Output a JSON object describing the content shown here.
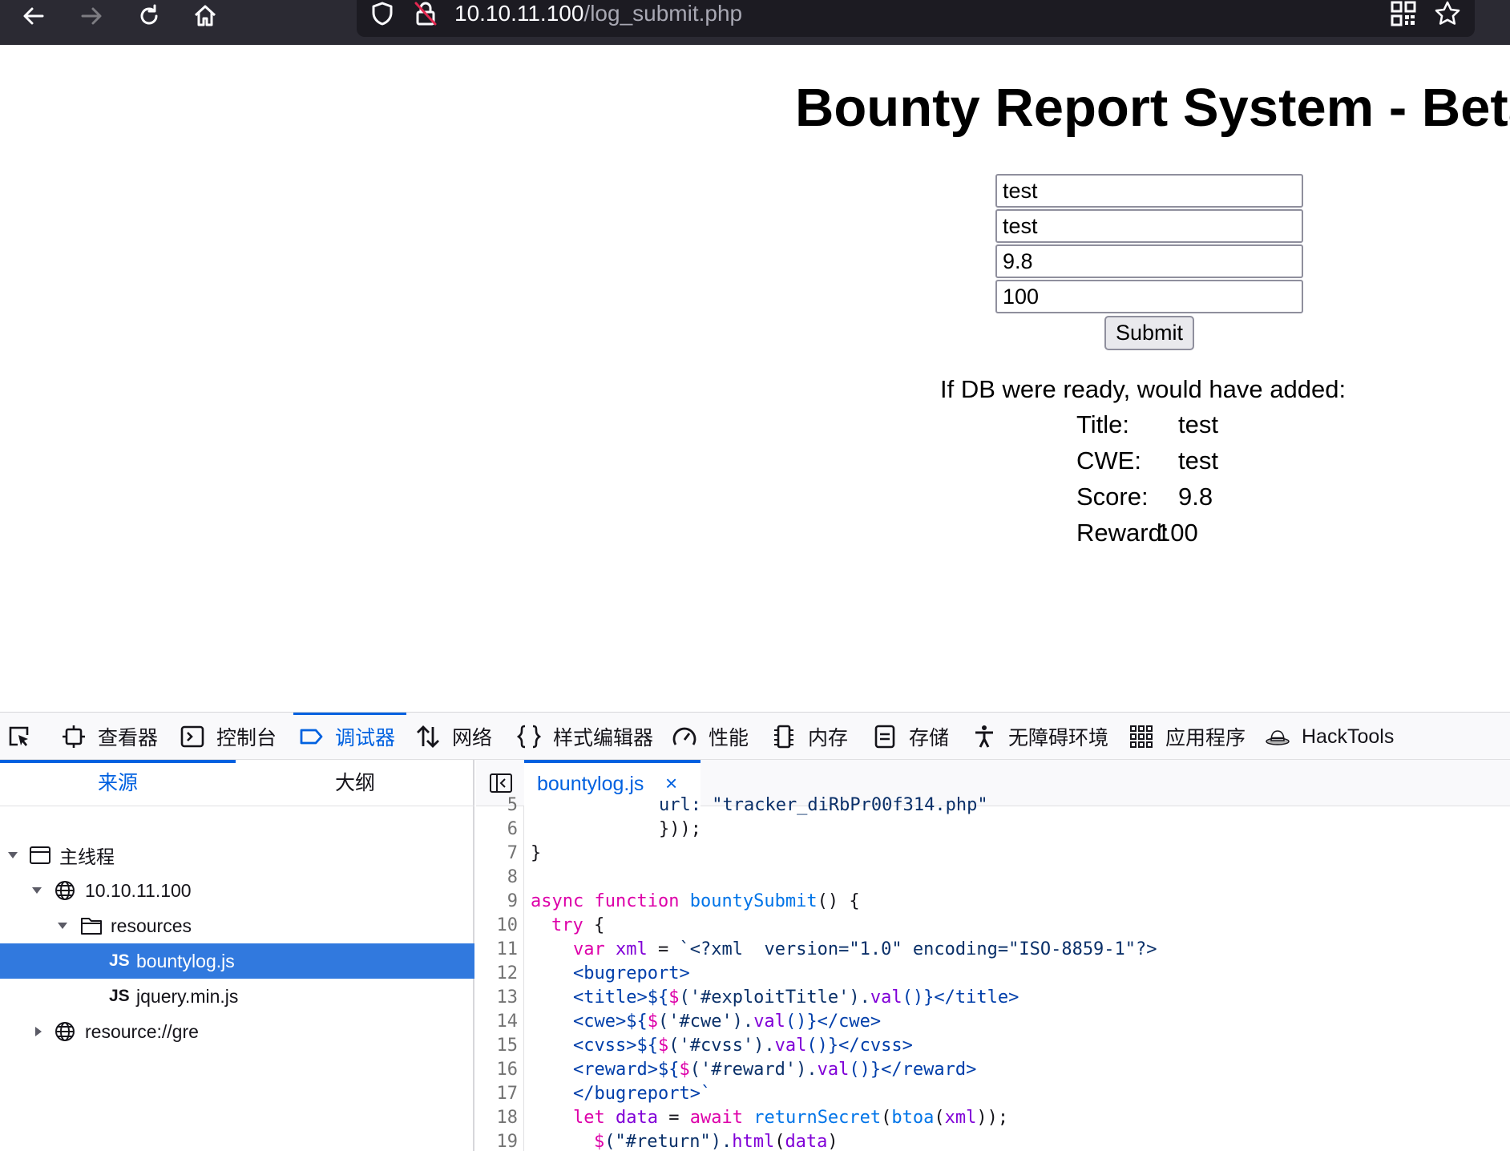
{
  "browser": {
    "url_host": "10.10.11.100",
    "url_path": "/log_submit.php"
  },
  "page": {
    "title": "Bounty Report System - Beta",
    "fields": {
      "title_value": "test",
      "cwe_value": "test",
      "score_value": "9.8",
      "reward_value": "100"
    },
    "submit_label": "Submit",
    "result_message": "If DB were ready, would have added:",
    "results": [
      {
        "label": "Title:",
        "value": "test"
      },
      {
        "label": "CWE:",
        "value": "test"
      },
      {
        "label": "Score:",
        "value": "9.8"
      },
      {
        "label": "Reward:",
        "value": "100"
      }
    ]
  },
  "devtools": {
    "tabs": [
      {
        "label": "查看器",
        "icon": "inspector-icon"
      },
      {
        "label": "控制台",
        "icon": "console-icon"
      },
      {
        "label": "调试器",
        "icon": "debugger-icon",
        "active": true
      },
      {
        "label": "网络",
        "icon": "network-icon"
      },
      {
        "label": "样式编辑器",
        "icon": "style-editor-icon"
      },
      {
        "label": "性能",
        "icon": "performance-icon"
      },
      {
        "label": "内存",
        "icon": "memory-icon"
      },
      {
        "label": "存储",
        "icon": "storage-icon"
      },
      {
        "label": "无障碍环境",
        "icon": "accessibility-icon"
      },
      {
        "label": "应用程序",
        "icon": "application-icon"
      },
      {
        "label": "HackTools",
        "icon": "hacktools-icon"
      }
    ],
    "sources": {
      "tab_sources": "来源",
      "tab_outline": "大纲",
      "tree": {
        "thread": "主线程",
        "host": "10.10.11.100",
        "folder": "resources",
        "file_selected": "bountylog.js",
        "file_other": "jquery.min.js",
        "resource": "resource://gre",
        "js_badge": "JS"
      }
    },
    "editor": {
      "open_file": "bountylog.js",
      "close_glyph": "×",
      "line_numbers": [
        "5",
        "6",
        "7",
        "8",
        "9",
        "10",
        "11",
        "12",
        "13",
        "14",
        "15",
        "16",
        "17",
        "18",
        "19"
      ],
      "code": {
        "l5": "url: \"tracker_diRbPr00f314.php\"",
        "l6": "}));",
        "l7": "}",
        "l9_kw1": "async",
        "l9_kw2": "function",
        "l9_fn": "bountySubmit",
        "l9_rest": "() {",
        "l10_kw": "try",
        "l10_rest": " {",
        "l11_kw": "var",
        "l11_var": "xml",
        "l11_op": " = ",
        "l11_str": "`<?xml  version=\"1.0\" encoding=\"ISO-8859-1\"?>",
        "l12": "<bugreport>",
        "l13_a": "<title>${",
        "l13_b": "$",
        "l13_c": "('#exploitTitle').",
        "l13_d": "val",
        "l13_e": "()}</title>",
        "l14_a": "<cwe>${",
        "l14_b": "$",
        "l14_c": "('#cwe').",
        "l14_d": "val",
        "l14_e": "()}</cwe>",
        "l15_a": "<cvss>${",
        "l15_b": "$",
        "l15_c": "('#cvss').",
        "l15_d": "val",
        "l15_e": "()}</cvss>",
        "l16_a": "<reward>${",
        "l16_b": "$",
        "l16_c": "('#reward').",
        "l16_d": "val",
        "l16_e": "()}</reward>",
        "l17": "</bugreport>`",
        "l18_kw": "let",
        "l18_var": "data",
        "l18_op": " = ",
        "l18_kw2": "await",
        "l18_fn": "returnSecret",
        "l18_p1": "(",
        "l18_fn2": "btoa",
        "l18_p2": "(",
        "l18_var2": "xml",
        "l18_p3": "));",
        "l19_a": "$",
        "l19_b": "(\"#return\").",
        "l19_c": "html",
        "l19_d": "(",
        "l19_e": "data",
        "l19_f": ")"
      }
    }
  },
  "colors": {
    "toolbar_bg": "#2b2a33",
    "accent": "#0061e0",
    "selection": "#3179de"
  }
}
